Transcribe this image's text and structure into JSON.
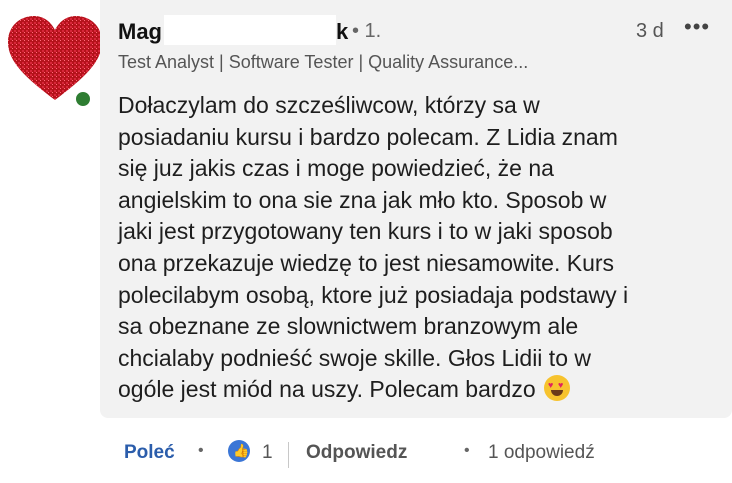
{
  "comment": {
    "author_visible_start": "Mag",
    "author_visible_end": "k",
    "connection_degree": "• 1.",
    "time_ago": "3 d",
    "more_icon": "more-horizontal-icon",
    "headline": "Test Analyst | Software Tester | Quality Assurance...",
    "text": "Dołaczylam do szcześliwcow, którzy sa w\nposiadaniu kursu i bardzo polecam. Z Lidia znam\nsię juz jakis czas i moge powiedzieć, że na\nangielskim to ona sie zna jak mło kto. Sposob w\njaki jest przygotowany ten kurs i to w jaki sposob\nona przekazuje wiedzę to jest niesamowite. Kurs\npolecilabym osobą, ktore już posiadaja podstawy i\nsa obeznane ze slownictwem branzowym ale\nchcialaby podnieść swoje skille. Głos Lidii to w\nogóle jest miód na uszy. Polecam bardzo ",
    "emoji": "heart-eyes-emoji"
  },
  "actions": {
    "recommend_label": "Poleć",
    "reaction_count": "1",
    "reply_label": "Odpowiedz",
    "replies_label": "1 odpowiedź"
  },
  "colors": {
    "accent": "#2b5dab",
    "bubble": "#f2f2f2",
    "like": "#3b76d6"
  }
}
